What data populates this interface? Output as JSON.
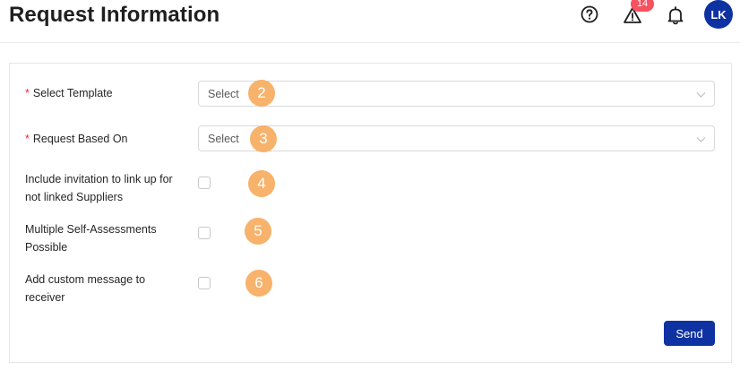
{
  "header": {
    "title": "Request Information",
    "icons": [
      "help-icon",
      "alert-icon",
      "bell-icon"
    ],
    "alert_count": "14",
    "avatar_initials": "LK"
  },
  "form": {
    "select_template": {
      "label": "Select Template",
      "required": true,
      "value": "Select",
      "marker": "2"
    },
    "request_based_on": {
      "label": "Request Based On",
      "required": true,
      "value": "Select",
      "marker": "3"
    },
    "include_invitation": {
      "label_line1": "Include invitation to link up for",
      "label_line2": "not linked Suppliers",
      "checked": false,
      "marker": "4"
    },
    "multiple_self_assessments": {
      "label_line1": "Multiple Self-Assessments",
      "label_line2": "Possible",
      "checked": false,
      "marker": "5"
    },
    "custom_message": {
      "label_line1": "Add custom message to",
      "label_line2": "receiver",
      "checked": false,
      "marker": "6"
    },
    "required_mark": "*",
    "send_label": "Send"
  },
  "colors": {
    "primary": "#0f32a2",
    "badge": "#f5515f",
    "marker": "#f7b26b",
    "required": "#f5222d"
  }
}
